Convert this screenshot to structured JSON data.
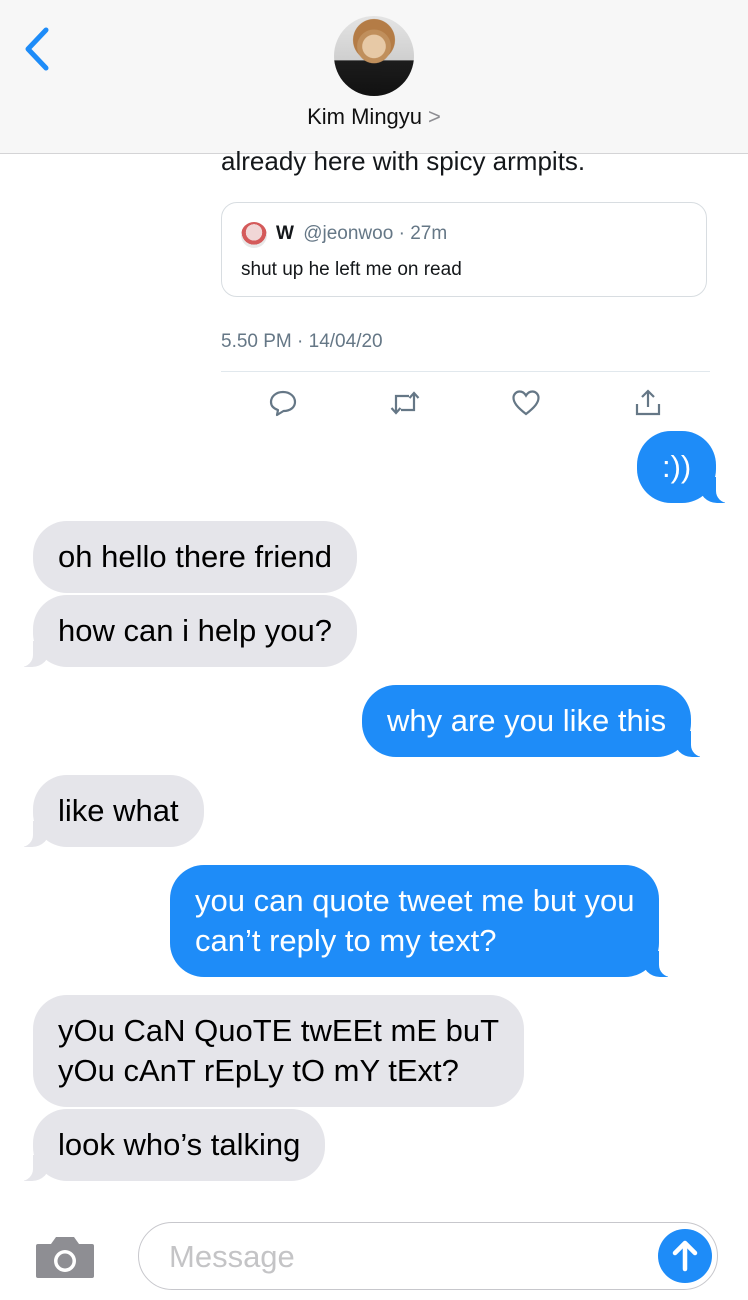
{
  "header": {
    "contact_name": "Kim Mingyu",
    "chevron": ">",
    "back_icon": "chevron-left-icon",
    "accent_color": "#1e8cf8"
  },
  "tweet": {
    "text_tail": "already here with spicy armpits.",
    "quote": {
      "name": "W",
      "handle": "@jeonwoo",
      "separator": "·",
      "age": "27m",
      "text": "shut up he left me on read"
    },
    "timestamp": "5.50 PM · 14/04/20",
    "actions": [
      "reply-icon",
      "retweet-icon",
      "like-icon",
      "share-icon"
    ]
  },
  "messages": [
    {
      "from": "me",
      "text": ":))"
    },
    {
      "from": "them",
      "text": "oh hello there friend"
    },
    {
      "from": "them",
      "text": "how can i help you?"
    },
    {
      "from": "me",
      "text": "why are you like this"
    },
    {
      "from": "them",
      "text": "like what"
    },
    {
      "from": "me",
      "lines": [
        "you can quote tweet me but you",
        "can’t reply to my text?"
      ]
    },
    {
      "from": "them",
      "lines": [
        "yOu CaN QuoTE twEEt mE buT",
        "yOu cAnT rEpLy tO mY tExt?"
      ]
    },
    {
      "from": "them",
      "text": "look who’s talking"
    }
  ],
  "input_bar": {
    "placeholder": "Message",
    "camera_icon": "camera-icon",
    "send_icon": "arrow-up-icon"
  }
}
